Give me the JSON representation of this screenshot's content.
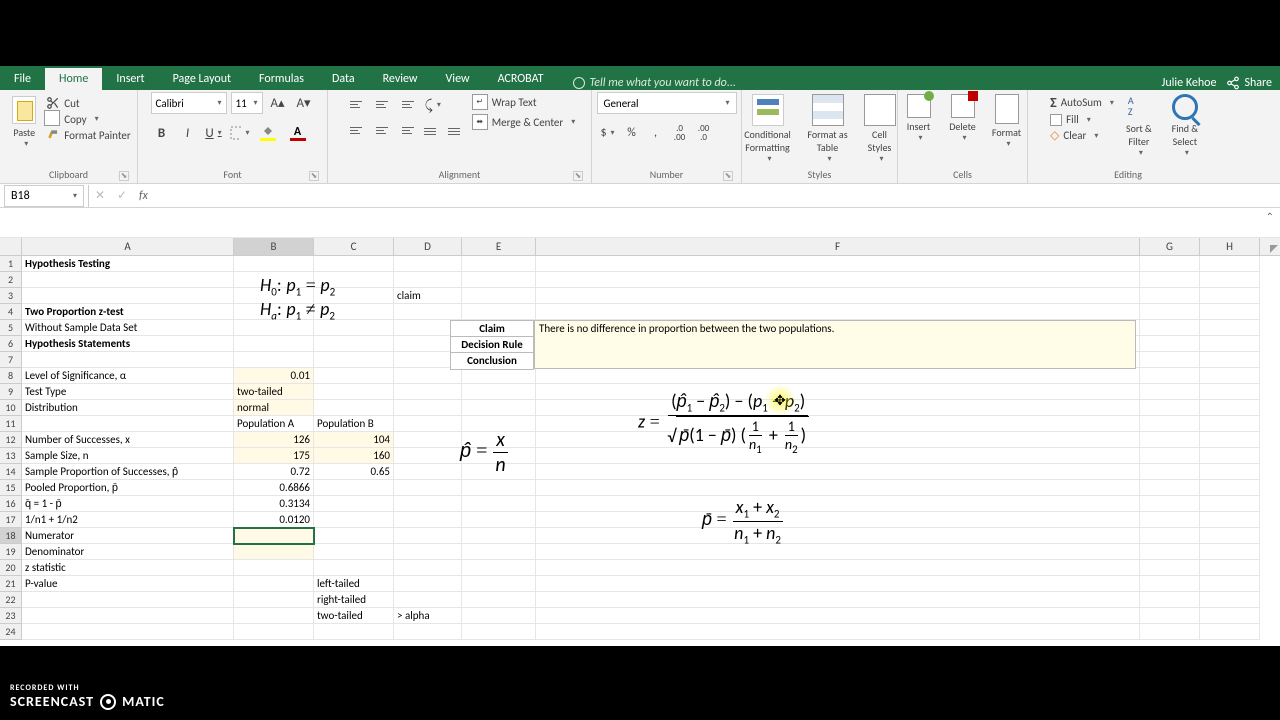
{
  "app": {
    "username": "Julie Kehoe",
    "share": "Share",
    "tellme": "Tell me what you want to do..."
  },
  "tabs": {
    "file": "File",
    "home": "Home",
    "insert": "Insert",
    "page_layout": "Page Layout",
    "formulas": "Formulas",
    "data": "Data",
    "review": "Review",
    "view": "View",
    "acrobat": "ACROBAT"
  },
  "ribbon": {
    "clipboard": {
      "label": "Clipboard",
      "paste": "Paste",
      "cut": "Cut",
      "copy": "Copy",
      "format_painter": "Format Painter"
    },
    "font": {
      "label": "Font",
      "name": "Calibri",
      "size": "11"
    },
    "alignment": {
      "label": "Alignment",
      "wrap": "Wrap Text",
      "merge": "Merge & Center"
    },
    "number": {
      "label": "Number",
      "format": "General"
    },
    "styles": {
      "label": "Styles",
      "cf": "Conditional Formatting",
      "fat": "Format as Table",
      "cs": "Cell Styles"
    },
    "cells": {
      "label": "Cells",
      "insert": "Insert",
      "delete": "Delete",
      "format": "Format"
    },
    "editing": {
      "label": "Editing",
      "autosum": "AutoSum",
      "fill": "Fill",
      "clear": "Clear",
      "sort": "Sort & Filter",
      "find": "Find & Select"
    }
  },
  "nameBox": "B18",
  "columns": [
    "A",
    "B",
    "C",
    "D",
    "E",
    "F",
    "G",
    "H"
  ],
  "cells": {
    "A1": "Hypothesis Testing",
    "A4": "Two Proportion z-test",
    "A5": "Without Sample Data Set",
    "A6": "Hypothesis Statements",
    "A8": "Level of Significance, α",
    "A9": "Test Type",
    "A10": "Distribution",
    "A12": "Number of Successes, x",
    "A13": "Sample Size, n",
    "A14": "Sample Proportion of Successes, p̂",
    "A15": "Pooled Proportion, p̄",
    "A16": "q̄ = 1 -  p̄",
    "A17": "1/n1 + 1/n2",
    "A18": "Numerator",
    "A19": "Denominator",
    "A20": "z statistic",
    "A21": "P-value",
    "B8": "0.01",
    "B9": "two-tailed",
    "B10": "normal",
    "B11": "Population A",
    "C11": "Population B",
    "B12": "126",
    "C12": "104",
    "B13": "175",
    "C13": "160",
    "B14": "0.72",
    "C14": "0.65",
    "B15": "0.6866",
    "B16": "0.3134",
    "B17": "0.0120",
    "C21": "left-tailed",
    "C22": "right-tailed",
    "C23": "two-tailed",
    "D3": "claim",
    "D23": "> alpha",
    "E6": "Claim",
    "E7": "Decision Rule",
    "E8": "Conclusion",
    "F6": "There is no difference in proportion between the two populations."
  },
  "formulas": {
    "h0": "H₀: p₁ = p₂",
    "ha": "Hₐ: p₁ ≠ p₂",
    "phat": "p̂ = x / n",
    "z_num": "(p̂₁ − p̂₂) − (p₁ − p₂)",
    "z_den": "√( p̄(1 − p̄) (1/n₁ + 1/n₂) )",
    "pbar_num": "x₁ + x₂",
    "pbar_den": "n₁ + n₂"
  },
  "watermark": {
    "line1": "RECORDED WITH",
    "line2": "SCREENCAST",
    "line3": "MATIC"
  }
}
